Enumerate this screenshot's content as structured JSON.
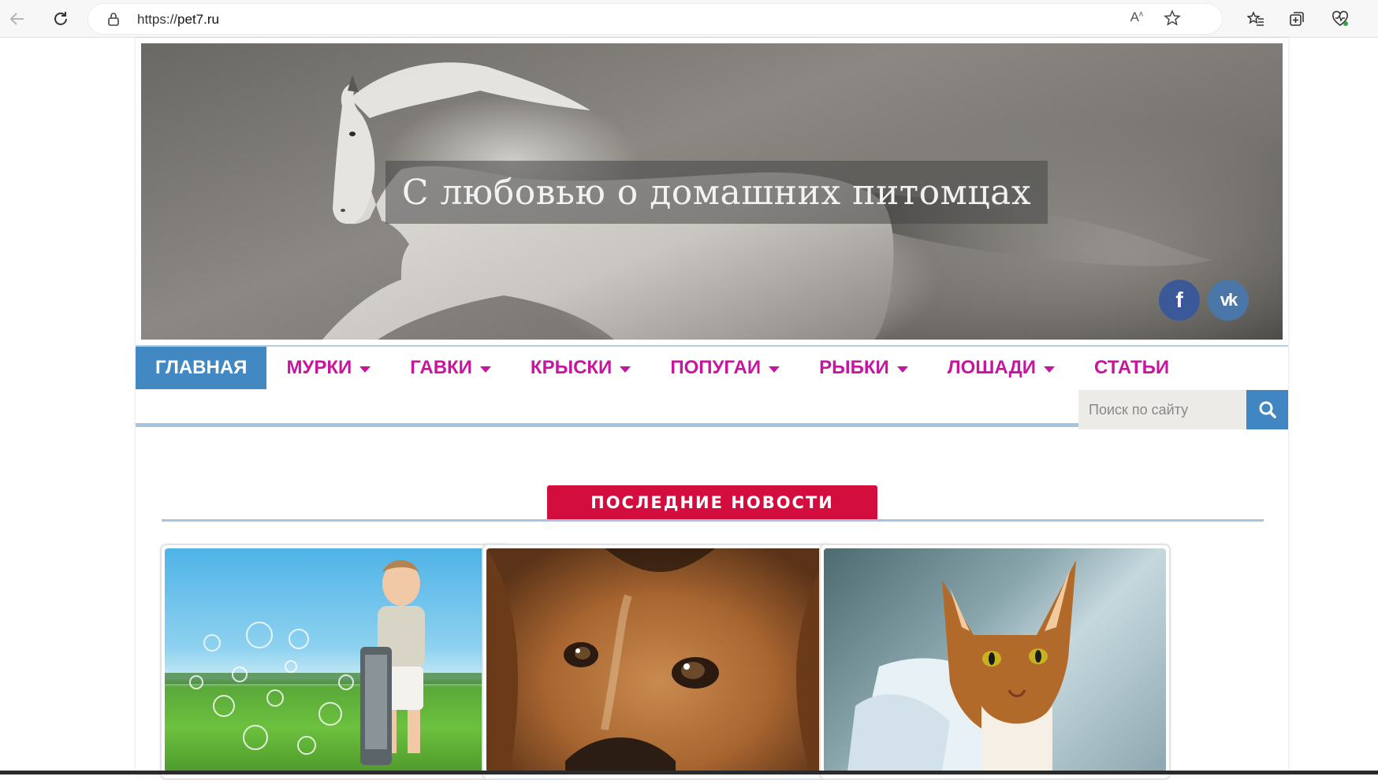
{
  "browser": {
    "url_scheme": "https://",
    "url_host": "pet7.ru"
  },
  "site": {
    "title": "С любовью о домашних питомцах"
  },
  "social": {
    "facebook": "f",
    "vk": "vk"
  },
  "menu": {
    "items": [
      {
        "label": "ГЛАВНАЯ",
        "active": true,
        "dropdown": false
      },
      {
        "label": "МУРКИ",
        "active": false,
        "dropdown": true
      },
      {
        "label": "ГАВКИ",
        "active": false,
        "dropdown": true
      },
      {
        "label": "КРЫСКИ",
        "active": false,
        "dropdown": true
      },
      {
        "label": "ПОПУГАИ",
        "active": false,
        "dropdown": true
      },
      {
        "label": "РЫБКИ",
        "active": false,
        "dropdown": true
      },
      {
        "label": "ЛОШАДИ",
        "active": false,
        "dropdown": true
      },
      {
        "label": "СТАТЬИ",
        "active": false,
        "dropdown": false
      }
    ]
  },
  "search": {
    "placeholder": "Поиск по сайту"
  },
  "news": {
    "heading": "ПОСЛЕДНИЕ НОВОСТИ",
    "cards": [
      {
        "image": "child-with-bubble-mower"
      },
      {
        "image": "beagle-closeup"
      },
      {
        "image": "abyssinian-cat"
      }
    ]
  },
  "colors": {
    "menu_text": "#c6169f",
    "menu_active_bg": "#4289c3",
    "news_heading_bg": "#d40d3f",
    "search_button": "#3f86c2"
  }
}
